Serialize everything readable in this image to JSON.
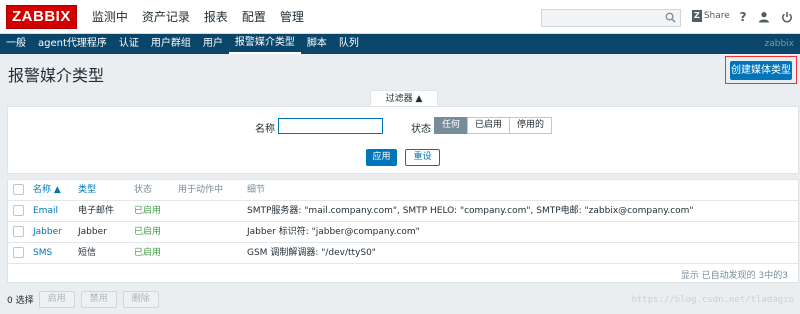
{
  "brand": {
    "logo": "ZABBIX",
    "right_name": "zabbix"
  },
  "main_menu": [
    "监测中",
    "资产记录",
    "报表",
    "配置",
    "管理"
  ],
  "header": {
    "share_badge": "Z",
    "share_label": "Share",
    "help": "?",
    "user_icon": "user-icon",
    "power_icon": "power-icon"
  },
  "sub_menu": [
    "一般",
    "agent代理程序",
    "认证",
    "用户群组",
    "用户",
    "报警媒介类型",
    "脚本",
    "队列"
  ],
  "sub_menu_active_index": 5,
  "page": {
    "title": "报警媒介类型",
    "create_button": "创建媒体类型"
  },
  "filter": {
    "tab_label": "过滤器 ▲",
    "name_label": "名称",
    "name_value": "",
    "status_label": "状态",
    "status_options": [
      "任何",
      "已启用",
      "停用的"
    ],
    "status_selected": "任何",
    "apply": "应用",
    "reset": "重设"
  },
  "table": {
    "columns": [
      "名称 ▲",
      "类型",
      "状态",
      "用于动作中",
      "细节"
    ],
    "rows": [
      {
        "name": "Email",
        "type": "电子邮件",
        "status": "已启用",
        "used": "",
        "details": "SMTP服务器: \"mail.company.com\", SMTP HELO: \"company.com\", SMTP电邮: \"zabbix@company.com\""
      },
      {
        "name": "Jabber",
        "type": "Jabber",
        "status": "已启用",
        "used": "",
        "details": "Jabber 标识符: \"jabber@company.com\""
      },
      {
        "name": "SMS",
        "type": "短信",
        "status": "已启用",
        "used": "",
        "details": "GSM 调制解调器: \"/dev/ttyS0\""
      }
    ],
    "footer": "显示 已自动发现的 3中的3"
  },
  "bottom": {
    "selected": "0 选择",
    "buttons": [
      "启用",
      "禁用",
      "删除"
    ]
  },
  "watermark": "https://blog.csdn.net/tladagio",
  "colors": {
    "accent": "#0275b8",
    "nav_dark": "#0a466a",
    "logo_red": "#d40000",
    "enabled_green": "#429e47"
  }
}
